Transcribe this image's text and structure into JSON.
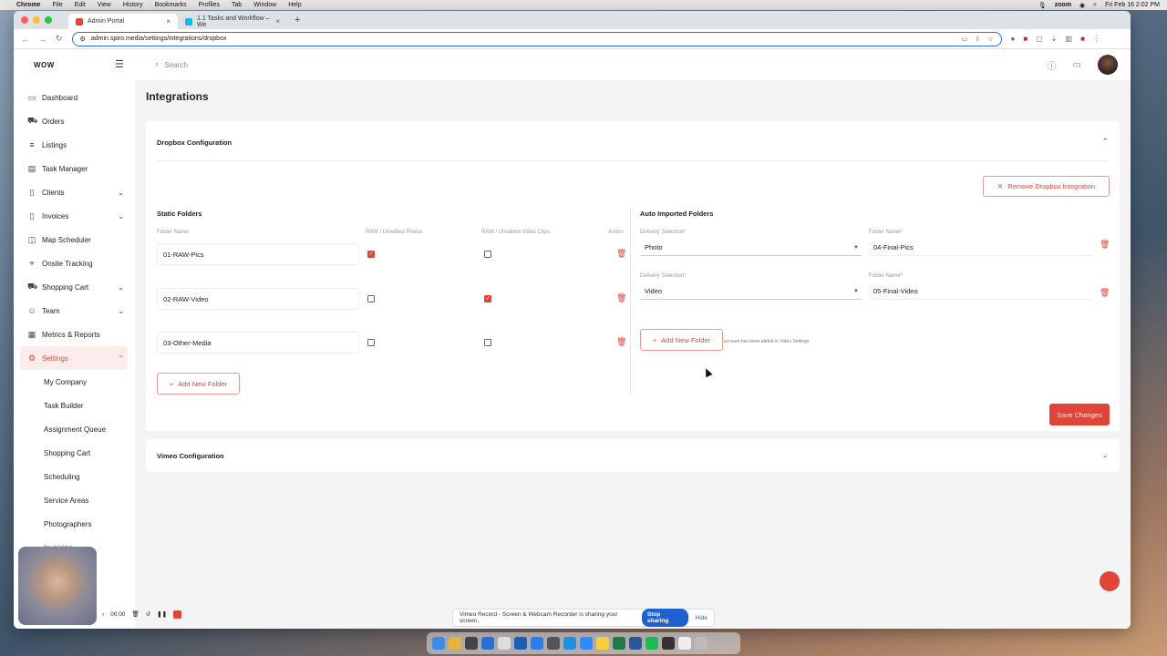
{
  "menubar": {
    "app": "Chrome",
    "items": [
      "File",
      "Edit",
      "View",
      "History",
      "Bookmarks",
      "Profiles",
      "Tab",
      "Window",
      "Help"
    ],
    "right_zoom": "zoom",
    "clock": "Fri Feb 16  2:02 PM"
  },
  "browser": {
    "tabs": [
      {
        "title": "Admin Portal",
        "active": true
      },
      {
        "title": "1.1 Tasks and Workflow – We",
        "active": false
      }
    ],
    "url": "admin.spiro.media/settings/integrations/dropbox"
  },
  "sidebar": {
    "logo": "WOW",
    "items": [
      {
        "label": "Dashboard",
        "icon": "monitor-icon",
        "chevron": false
      },
      {
        "label": "Orders",
        "icon": "cart-icon",
        "chevron": false
      },
      {
        "label": "Listings",
        "icon": "list-icon",
        "chevron": false
      },
      {
        "label": "Task Manager",
        "icon": "clipboard-icon",
        "chevron": false
      },
      {
        "label": "Clients",
        "icon": "document-icon",
        "chevron": true
      },
      {
        "label": "Invoices",
        "icon": "invoice-icon",
        "chevron": true
      },
      {
        "label": "Map Scheduler",
        "icon": "map-icon",
        "chevron": false
      },
      {
        "label": "Onsite Tracking",
        "icon": "location-icon",
        "chevron": false
      },
      {
        "label": "Shopping Cart",
        "icon": "cart-icon",
        "chevron": true
      },
      {
        "label": "Team",
        "icon": "users-icon",
        "chevron": true
      },
      {
        "label": "Metrics & Reports",
        "icon": "chart-icon",
        "chevron": false
      },
      {
        "label": "Settings",
        "icon": "gear-icon",
        "chevron": true,
        "active": true
      }
    ],
    "settings_sub": [
      "My Company",
      "Task Builder",
      "Assignment Queue",
      "Shopping Cart",
      "Scheduling",
      "Service Areas",
      "Photographers",
      "Invoicing"
    ]
  },
  "topbar": {
    "search_placeholder": "Search"
  },
  "page": {
    "title": "Integrations"
  },
  "dropbox": {
    "header": "Dropbox Configuration",
    "remove_label": "Remove Dropbox Integration",
    "static_title": "Static Folders",
    "columns": {
      "name": "Folder Name",
      "photos": "RAW / Unedited Photos",
      "video": "RAW / Unedited Video Clips",
      "action": "Action"
    },
    "static_folders": [
      {
        "name": "01-RAW-Pics",
        "photos": true,
        "video": false
      },
      {
        "name": "02-RAW-Video",
        "photos": false,
        "video": true
      },
      {
        "name": "03-Other-Media",
        "photos": false,
        "video": false
      }
    ],
    "add_folder_label": "Add New Folder",
    "auto_title": "Auto Imported Folders",
    "delivery_label": "Delivery Selection*",
    "folder_name_label": "Folder Name*",
    "auto_folders": [
      {
        "delivery": "Photo",
        "folder": "04-Final-Pics"
      },
      {
        "delivery": "Video",
        "folder": "05-Final-Video"
      }
    ],
    "video_note": "Videos will only be imported if a Vimeo account has been added in Video Settings",
    "save_label": "Save Changes"
  },
  "vimeo": {
    "header": "Vimeo Configuration"
  },
  "recorder": {
    "timer": "00:00"
  },
  "share_bar": {
    "message": "Vimeo Record - Screen & Webcam Recorder is sharing your screen.",
    "stop_label": "Stop sharing",
    "hide_label": "Hide"
  },
  "colors": {
    "accent": "#e0453a",
    "share_blue": "#1d62d0"
  }
}
